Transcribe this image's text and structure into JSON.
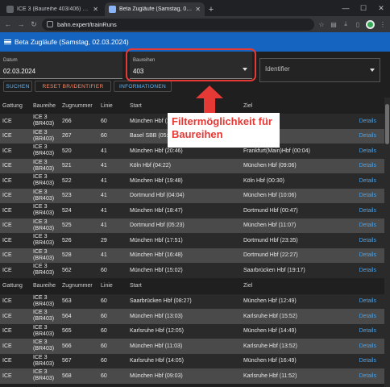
{
  "browser": {
    "tabs": [
      {
        "title": "ICE 3 (Baureihe 403/406) auf w...",
        "active": false
      },
      {
        "title": "Beta Zugläufe (Samstag, 02.03...",
        "active": true
      }
    ],
    "url": "bahn.expert/trainRuns"
  },
  "app": {
    "title": "Beta Zugläufe (Samstag, 02.03.2024)",
    "accent_color": "#1565c0"
  },
  "filters": {
    "date_label": "Datum",
    "date_value": "02.03.2024",
    "baureihe_label": "Baureihen",
    "baureihe_value": "403",
    "identifier_placeholder": "Identifier"
  },
  "buttons": {
    "search": "SUCHEN",
    "reset": "RESET BR/IDENTIFIER",
    "info": "INFORMATIONEN"
  },
  "annotation": {
    "text": "Filtermöglichkeit für Baureihen",
    "color": "#e53935"
  },
  "table": {
    "headers": [
      "Gattung",
      "Baureihe",
      "Zugnummer",
      "Linie",
      "Start",
      "Ziel",
      ""
    ],
    "rows_a": [
      {
        "gattung": "ICE",
        "br1": "ICE 3",
        "br2": "(BR403)",
        "nr": "266",
        "linie": "60",
        "start": "München Hbf (19:...",
        "ziel": "...bf (19:52)",
        "det": "Details"
      },
      {
        "gattung": "ICE",
        "br1": "ICE 3",
        "br2": "(BR403)",
        "nr": "267",
        "linie": "60",
        "start": "Basel SBB (05:5...",
        "ziel": "...hbf (10:49)",
        "det": "Details"
      },
      {
        "gattung": "ICE",
        "br1": "ICE 3",
        "br2": "(BR403)",
        "nr": "520",
        "linie": "41",
        "start": "München Hbf (20:46)",
        "ziel": "Frankfurt(Main)Hbf (00:04)",
        "det": "Details"
      },
      {
        "gattung": "ICE",
        "br1": "ICE 3",
        "br2": "(BR403)",
        "nr": "521",
        "linie": "41",
        "start": "Köln Hbf (04:22)",
        "ziel": "München Hbf (09:06)",
        "det": "Details"
      },
      {
        "gattung": "ICE",
        "br1": "ICE 3",
        "br2": "(BR403)",
        "nr": "522",
        "linie": "41",
        "start": "München Hbf (19:48)",
        "ziel": "Köln Hbf (00:30)",
        "det": "Details"
      },
      {
        "gattung": "ICE",
        "br1": "ICE 3",
        "br2": "(BR403)",
        "nr": "523",
        "linie": "41",
        "start": "Dortmund Hbf (04:04)",
        "ziel": "München Hbf (10:06)",
        "det": "Details"
      },
      {
        "gattung": "ICE",
        "br1": "ICE 3",
        "br2": "(BR403)",
        "nr": "524",
        "linie": "41",
        "start": "München Hbf (18:47)",
        "ziel": "Dortmund Hbf (00:47)",
        "det": "Details"
      },
      {
        "gattung": "ICE",
        "br1": "ICE 3",
        "br2": "(BR403)",
        "nr": "525",
        "linie": "41",
        "start": "Dortmund Hbf (05:23)",
        "ziel": "München Hbf (11:07)",
        "det": "Details"
      },
      {
        "gattung": "ICE",
        "br1": "ICE 3",
        "br2": "(BR403)",
        "nr": "526",
        "linie": "29",
        "start": "München Hbf (17:51)",
        "ziel": "Dortmund Hbf (23:35)",
        "det": "Details"
      },
      {
        "gattung": "ICE",
        "br1": "ICE 3",
        "br2": "(BR403)",
        "nr": "528",
        "linie": "41",
        "start": "München Hbf (16:48)",
        "ziel": "Dortmund Hbf (22:27)",
        "det": "Details"
      },
      {
        "gattung": "ICE",
        "br1": "ICE 3",
        "br2": "(BR403)",
        "nr": "562",
        "linie": "60",
        "start": "München Hbf (15:02)",
        "ziel": "Saarbrücken Hbf (19:17)",
        "det": "Details"
      }
    ],
    "rows_b": [
      {
        "gattung": "ICE",
        "br1": "ICE 3",
        "br2": "(BR403)",
        "nr": "563",
        "linie": "60",
        "start": "Saarbrücken Hbf (08:27)",
        "ziel": "München Hbf (12:49)",
        "det": "Details"
      },
      {
        "gattung": "ICE",
        "br1": "ICE 3",
        "br2": "(BR403)",
        "nr": "564",
        "linie": "60",
        "start": "München Hbf (13:03)",
        "ziel": "Karlsruhe Hbf (15:52)",
        "det": "Details"
      },
      {
        "gattung": "ICE",
        "br1": "ICE 3",
        "br2": "(BR403)",
        "nr": "565",
        "linie": "60",
        "start": "Karlsruhe Hbf (12:05)",
        "ziel": "München Hbf (14:49)",
        "det": "Details"
      },
      {
        "gattung": "ICE",
        "br1": "ICE 3",
        "br2": "(BR403)",
        "nr": "566",
        "linie": "60",
        "start": "München Hbf (11:03)",
        "ziel": "Karlsruhe Hbf (13:52)",
        "det": "Details"
      },
      {
        "gattung": "ICE",
        "br1": "ICE 3",
        "br2": "(BR403)",
        "nr": "567",
        "linie": "60",
        "start": "Karlsruhe Hbf (14:05)",
        "ziel": "München Hbf (16:49)",
        "det": "Details"
      },
      {
        "gattung": "ICE",
        "br1": "ICE 3",
        "br2": "(BR403)",
        "nr": "568",
        "linie": "60",
        "start": "München Hbf (09:03)",
        "ziel": "Karlsruhe Hbf (11:52)",
        "det": "Details"
      }
    ]
  }
}
